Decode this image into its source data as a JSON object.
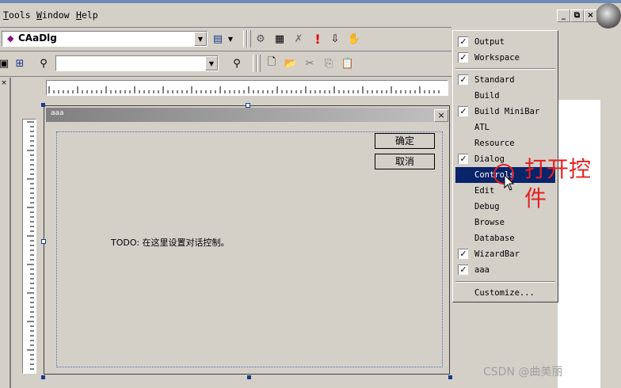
{
  "menubar": {
    "items": [
      "Tools",
      "Window",
      "Help"
    ]
  },
  "window_buttons": {
    "minimize": "_",
    "restore": "⧉",
    "close": "×"
  },
  "toolbar": {
    "class_combo_value": "CAaDlg",
    "second_combo_value": ""
  },
  "dialog": {
    "title": "aaa",
    "ok_label": "确定",
    "cancel_label": "取消",
    "todo_text": "TODO: 在这里设置对话控制。"
  },
  "context_menu": {
    "items": [
      {
        "label": "Output",
        "checked": true
      },
      {
        "label": "Workspace",
        "checked": true
      },
      {
        "label": "Standard",
        "checked": true
      },
      {
        "label": "Build",
        "checked": false
      },
      {
        "label": "Build MiniBar",
        "checked": true
      },
      {
        "label": "ATL",
        "checked": false
      },
      {
        "label": "Resource",
        "checked": false
      },
      {
        "label": "Dialog",
        "checked": true
      },
      {
        "label": "Controls",
        "checked": false,
        "selected": true
      },
      {
        "label": "Edit",
        "checked": false
      },
      {
        "label": "Debug",
        "checked": false
      },
      {
        "label": "Browse",
        "checked": false
      },
      {
        "label": "Database",
        "checked": false
      },
      {
        "label": "WizardBar",
        "checked": true
      },
      {
        "label": "aaa",
        "checked": true
      },
      {
        "label": "Customize...",
        "checked": false
      }
    ]
  },
  "annotation": {
    "text": "打开控件",
    "color": "#e52020"
  },
  "watermark": "CSDN @曲美丽",
  "colors": {
    "face": "#d4d0c8",
    "highlight": "#0a246a"
  }
}
